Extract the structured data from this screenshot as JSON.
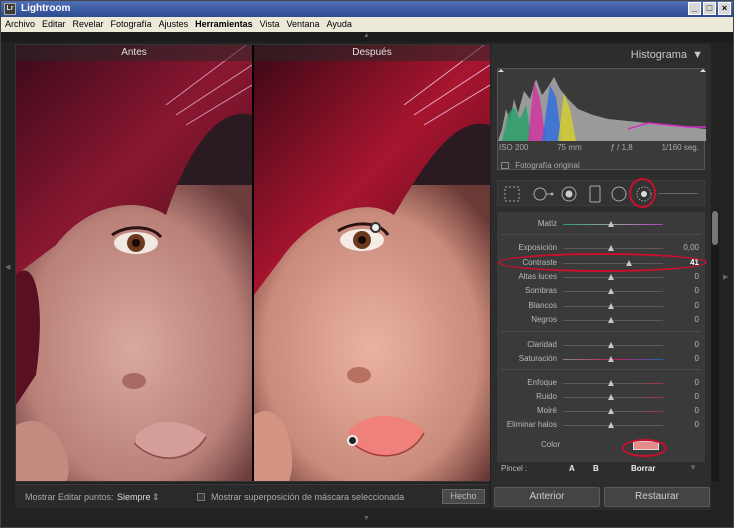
{
  "app": {
    "title": "Lightroom",
    "logo": "Lr"
  },
  "window_buttons": [
    "_",
    "□",
    "×"
  ],
  "menu": [
    "Archivo",
    "Editar",
    "Revelar",
    "Fotografía",
    "Ajustes",
    "Herramientas",
    "Vista",
    "Ventana",
    "Ayuda"
  ],
  "viewer": {
    "before_label": "Antes",
    "after_label": "Después"
  },
  "toolbar": {
    "show_points_label": "Mostrar Editar puntos:",
    "show_points_value": "Siempre",
    "overlay_label": "Mostrar superposición de máscara seleccionada",
    "done_label": "Hecho"
  },
  "panel": {
    "histogram_title": "Histograma",
    "meta": {
      "iso": "ISO 200",
      "focal": "75 mm",
      "aperture": "ƒ / 1,8",
      "shutter": "1/160 seg."
    },
    "original_label": "Fotografía original"
  },
  "adjustments": [
    {
      "label": "Matiz",
      "value": "",
      "pos": 0.48
    },
    {
      "label": "Exposición",
      "value": "0,00",
      "pos": 0.48
    },
    {
      "label": "Contraste",
      "value": "41",
      "pos": 0.66
    },
    {
      "label": "Altas luces",
      "value": "0",
      "pos": 0.48
    },
    {
      "label": "Sombras",
      "value": "0",
      "pos": 0.48
    },
    {
      "label": "Blancos",
      "value": "0",
      "pos": 0.48
    },
    {
      "label": "Negros",
      "value": "0",
      "pos": 0.48
    },
    {
      "label": "Claridad",
      "value": "0",
      "pos": 0.48
    },
    {
      "label": "Saturación",
      "value": "0",
      "pos": 0.48
    },
    {
      "label": "Enfoque",
      "value": "0",
      "pos": 0.48
    },
    {
      "label": "Ruido",
      "value": "0",
      "pos": 0.48
    },
    {
      "label": "Moiré",
      "value": "0",
      "pos": 0.48
    },
    {
      "label": "Eliminar halos",
      "value": "0",
      "pos": 0.48
    }
  ],
  "color_label": "Color",
  "brush": {
    "label": "Pincel :",
    "a": "A",
    "b": "B",
    "erase": "Borrar"
  },
  "buttons": {
    "previous": "Anterior",
    "reset": "Restaurar"
  },
  "colors": {
    "accent_red": "#c8102e",
    "panel_bg": "#2d2d2d",
    "title_blue": "#2d4a8f"
  }
}
